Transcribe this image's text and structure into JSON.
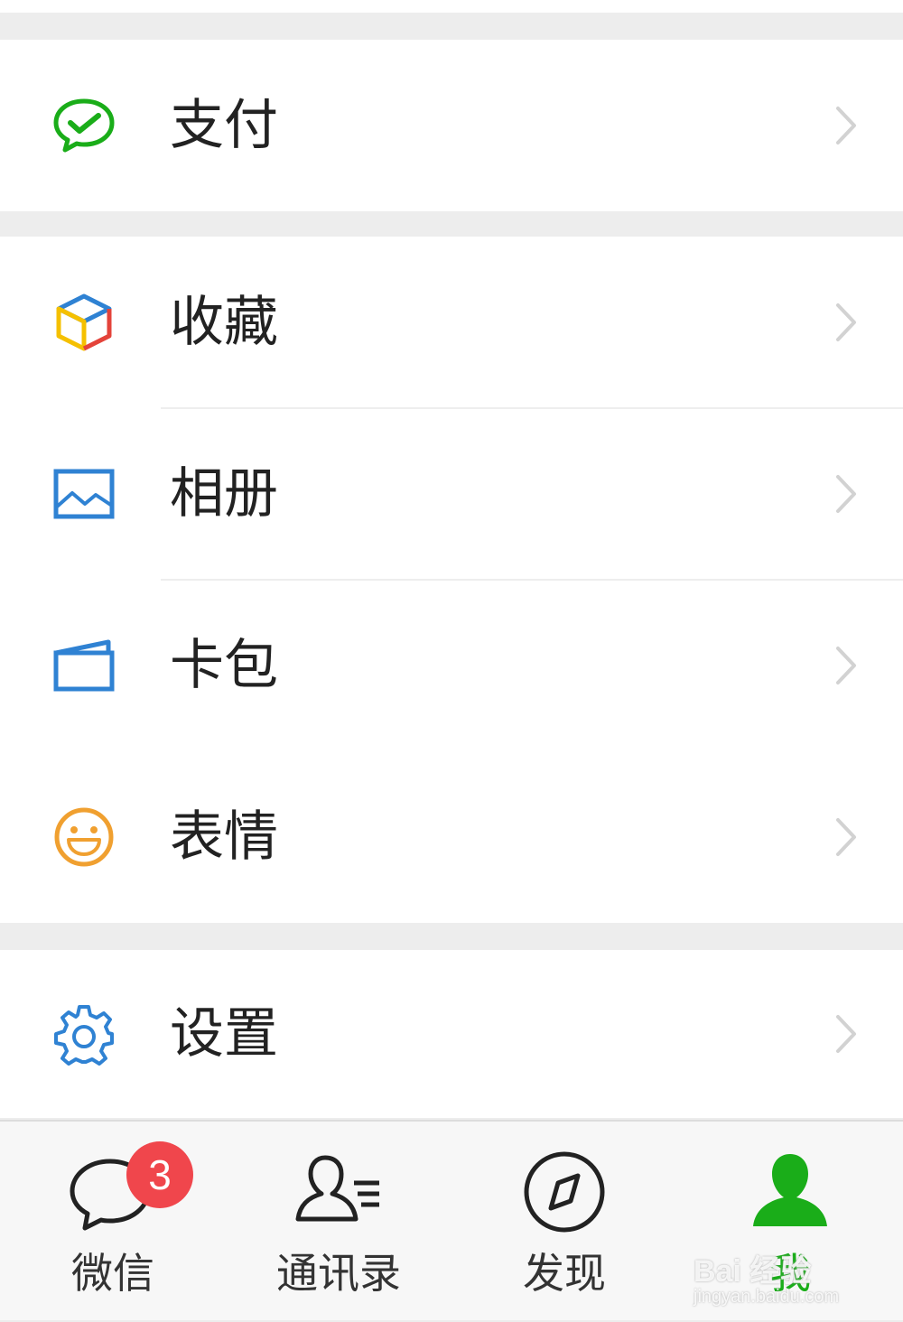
{
  "menu": {
    "groups": [
      {
        "items": [
          {
            "label": "支付",
            "icon": "wechat-pay-icon"
          }
        ]
      },
      {
        "items": [
          {
            "label": "收藏",
            "icon": "favorites-cube-icon"
          },
          {
            "label": "相册",
            "icon": "album-picture-icon"
          },
          {
            "label": "卡包",
            "icon": "card-wallet-icon"
          },
          {
            "label": "表情",
            "icon": "smiley-face-icon"
          }
        ]
      },
      {
        "items": [
          {
            "label": "设置",
            "icon": "gear-icon"
          }
        ]
      }
    ]
  },
  "tabbar": {
    "tabs": [
      {
        "label": "微信",
        "icon": "chat-bubble-icon",
        "badge": "3",
        "active": false
      },
      {
        "label": "通讯录",
        "icon": "contacts-icon",
        "active": false
      },
      {
        "label": "发现",
        "icon": "compass-icon",
        "active": false
      },
      {
        "label": "我",
        "icon": "person-icon",
        "active": true
      }
    ]
  },
  "watermark": {
    "brand": "Bai  经验",
    "url": "jingyan.baidu.com"
  },
  "colors": {
    "active_green": "#1aad19",
    "badge_red": "#f0464c",
    "pay_green": "#1aad19",
    "blue_icon": "#2f82d3",
    "smiley_orange": "#f0a030"
  }
}
